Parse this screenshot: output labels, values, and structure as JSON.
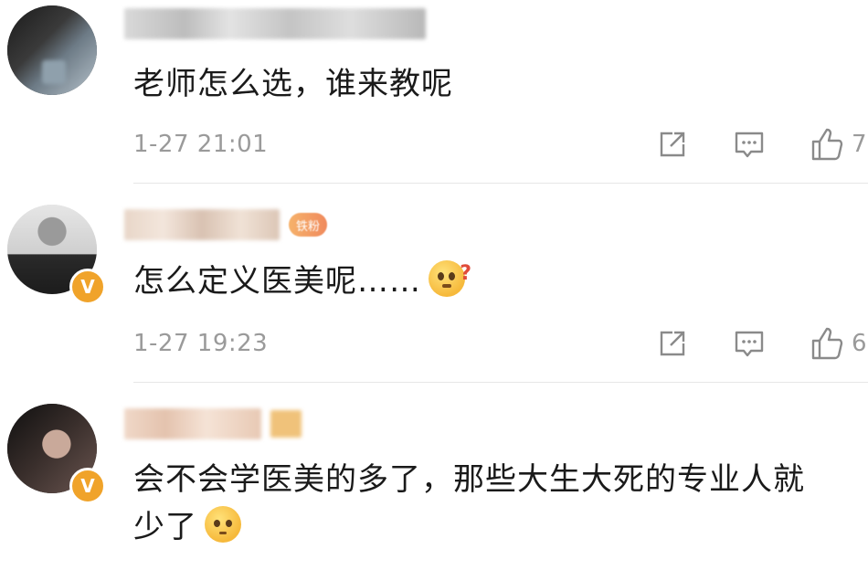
{
  "comments": [
    {
      "username_hidden": true,
      "text": "老师怎么选，谁来教呢",
      "time": "1-27 21:01",
      "likes": "7",
      "verified": false
    },
    {
      "username_hidden": true,
      "badge": "铁粉",
      "text": "怎么定义医美呢……",
      "time": "1-27 19:23",
      "likes": "6",
      "verified": true,
      "verified_label": "V"
    },
    {
      "username_hidden": true,
      "text_line1": "会不会学医美的多了，那些大生大死的专业人就",
      "text_line2": "少了",
      "verified": true,
      "verified_label": "V"
    }
  ],
  "icons": {
    "share": "share-icon",
    "comment": "comment-icon",
    "like": "thumbs-up-icon"
  },
  "colors": {
    "text": "#1a1a1a",
    "meta": "#9a9a9a",
    "badge": "#f0a32a",
    "divider": "#e6e6e6"
  }
}
